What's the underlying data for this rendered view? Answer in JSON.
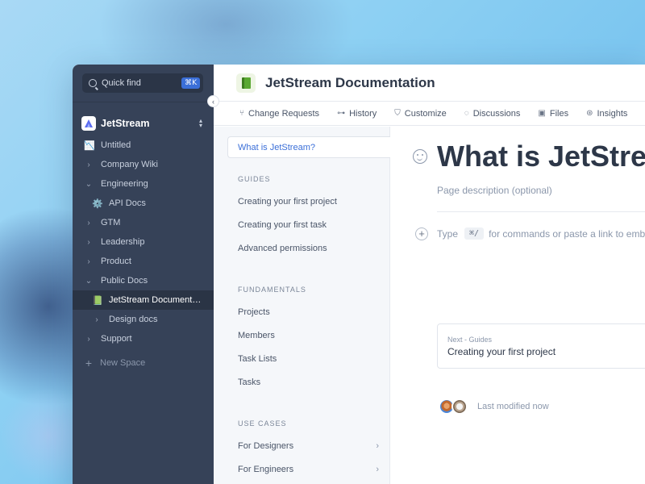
{
  "quick_find": {
    "label": "Quick find",
    "shortcut": "⌘K"
  },
  "workspace": {
    "name": "JetStream"
  },
  "sidebar": {
    "items": [
      {
        "label": "Untitled",
        "icon": "chart-emoji"
      },
      {
        "label": "Company Wiki",
        "icon": "chevron-right-icon"
      },
      {
        "label": "Engineering",
        "icon": "chevron-down-icon"
      },
      {
        "label": "API Docs",
        "icon": "gear-emoji"
      },
      {
        "label": "GTM",
        "icon": "chevron-right-icon"
      },
      {
        "label": "Leadership",
        "icon": "chevron-right-icon"
      },
      {
        "label": "Product",
        "icon": "chevron-right-icon"
      },
      {
        "label": "Public Docs",
        "icon": "chevron-down-icon"
      },
      {
        "label": "JetStream Document…",
        "icon": "book-emoji"
      },
      {
        "label": "Design docs",
        "icon": "chevron-right-icon"
      },
      {
        "label": "Support",
        "icon": "chevron-right-icon"
      }
    ],
    "new_space": "New Space"
  },
  "header": {
    "title": "JetStream Documentation"
  },
  "tabs": [
    {
      "label": "Change Requests",
      "icon": "branch-icon"
    },
    {
      "label": "History",
      "icon": "history-icon"
    },
    {
      "label": "Customize",
      "icon": "brush-icon"
    },
    {
      "label": "Discussions",
      "icon": "chat-icon"
    },
    {
      "label": "Files",
      "icon": "image-icon"
    },
    {
      "label": "Insights",
      "icon": "insights-icon"
    }
  ],
  "subnav": {
    "active": "What is JetStream?",
    "guides_heading": "GUIDES",
    "guides": [
      "Creating your first project",
      "Creating your first task",
      "Advanced permissions"
    ],
    "fundamentals_heading": "FUNDAMENTALS",
    "fundamentals": [
      "Projects",
      "Members",
      "Task Lists",
      "Tasks"
    ],
    "use_cases_heading": "USE CASES",
    "use_cases": [
      "For Designers",
      "For Engineers"
    ]
  },
  "content": {
    "title": "What is JetStream?",
    "description": "Page description (optional)",
    "type_prefix": "Type",
    "type_shortcut": "⌘/",
    "type_suffix": "for commands or paste a link to embed content",
    "next_label": "Next - Guides",
    "next_title": "Creating your first project",
    "last_modified": "Last modified now"
  },
  "colors": {
    "sidebar_bg": "#364258",
    "accent": "#3b6fd8",
    "book_green": "#5aa832"
  }
}
